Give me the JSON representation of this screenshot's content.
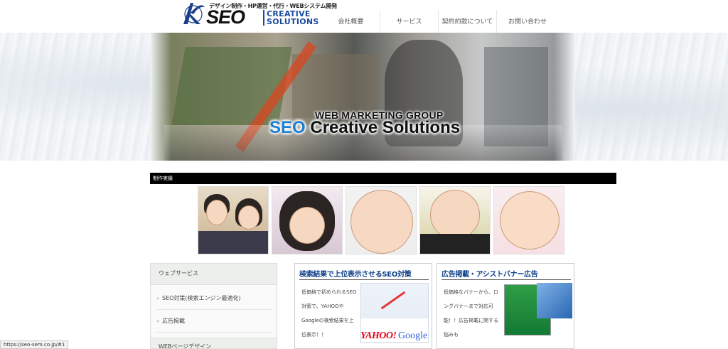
{
  "header": {
    "logo_tagline": "デザイン制作・HP運営・代行・WEBシステム開発",
    "logo_seo": "SEO",
    "logo_cs_line1": "CREATIVE",
    "logo_cs_line2": "SOLUTIONS"
  },
  "nav": {
    "items": [
      "会社概要",
      "サービス",
      "契約約款について",
      "お問い合わせ"
    ]
  },
  "hero": {
    "subtitle": "WEB MARKETING GROUP",
    "title_accent": "SEO",
    "title_rest": " Creative Solutions"
  },
  "works": {
    "label": "制作実績"
  },
  "sidebar": {
    "heading": "ウェブサービス",
    "items": [
      "SEO対策(検索エンジン最適化)",
      "広告掲載",
      "WEBページデザイン"
    ]
  },
  "cards": [
    {
      "title": "検索結果で上位表示させるSEO対策",
      "text": "低価格で初められるSEO対策で、YAHOOやGoogleの検索結果を上位表示！！",
      "logo_yahoo": "YAHOO!",
      "logo_google": "Google"
    },
    {
      "title": "広告掲載・アシストバナー広告",
      "text": "低価格なバナーから、ロングバナーまで対応可能！！広告掲載に関する悩みも"
    }
  ],
  "status_bar": {
    "url": "https://seo-sem.co.jp/#1"
  }
}
